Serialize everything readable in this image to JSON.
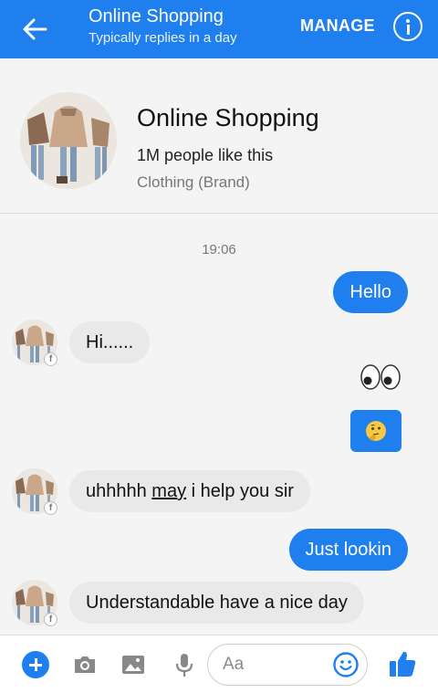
{
  "header": {
    "title": "Online Shopping",
    "subtitle": "Typically replies in a day",
    "manage_label": "MANAGE"
  },
  "profile": {
    "name": "Online Shopping",
    "likes": "1M people like this",
    "category": "Clothing (Brand)"
  },
  "conversation": {
    "timestamp": "19:06",
    "messages": [
      {
        "direction": "outgoing",
        "text": "Hello"
      },
      {
        "direction": "incoming",
        "text": "Hi......"
      },
      {
        "direction": "outgoing",
        "type": "emoji",
        "icon": "eyes-emoji"
      },
      {
        "direction": "outgoing",
        "type": "emoji",
        "icon": "thinking-face-emoji"
      },
      {
        "direction": "incoming",
        "parts": [
          "uhhhhh ",
          "may",
          " i help you sir"
        ]
      },
      {
        "direction": "outgoing",
        "text": "Just lookin"
      },
      {
        "direction": "incoming",
        "text": "Understandable have a nice day"
      }
    ]
  },
  "composer": {
    "placeholder": "Aa"
  },
  "colors": {
    "accent": "#1f7fee",
    "incoming_bubble": "#e9e9ea",
    "background": "#f4f4f4"
  }
}
